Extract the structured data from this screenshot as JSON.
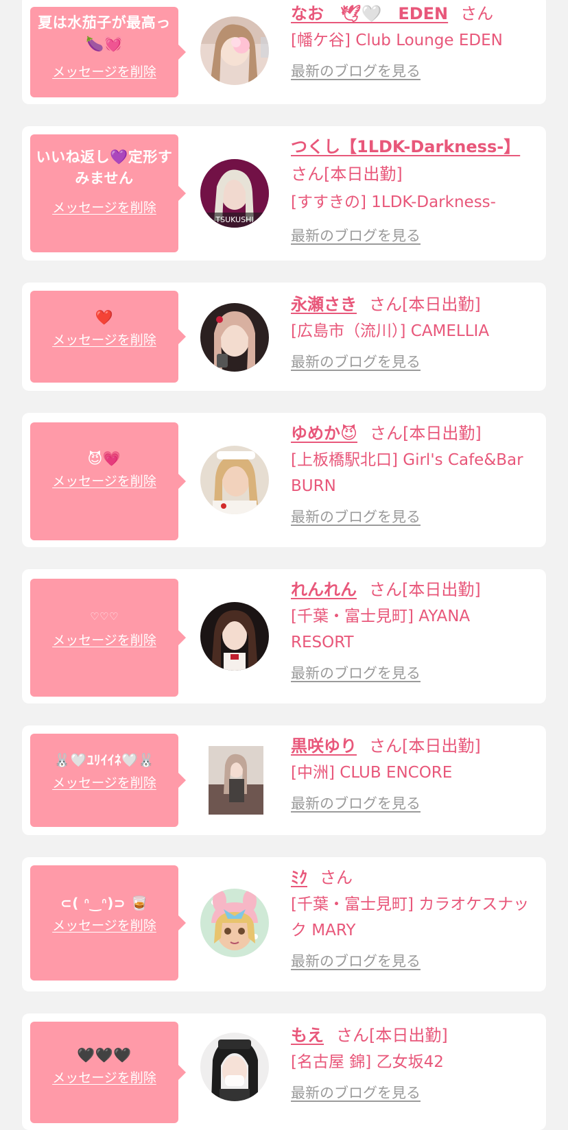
{
  "colors": {
    "background": "#f2f2f2",
    "card": "#ffffff",
    "bubble": "#ff9aa8",
    "accent": "#e8577a",
    "muted_link": "#9a9a9a"
  },
  "entries": [
    {
      "message": "夏は水茄子が最高っ🍆💓",
      "delete_label": "メッセージを削除",
      "name": "なお　🕊🤍　EDEN",
      "san": "さん",
      "status": "",
      "shop": "[幡ケ谷] Club Lounge EDEN",
      "blog_label": "最新のブログを見る",
      "avatar_icon": "avatar-photo"
    },
    {
      "message": "いいね返し💜定形すみません",
      "delete_label": "メッセージを削除",
      "name": "つくし【1LDK-Darkness-】",
      "san": "さん",
      "status": "[本日出勤]",
      "shop": "[すすきの] 1LDK-Darkness-",
      "blog_label": "最新のブログを見る",
      "avatar_icon": "avatar-photo"
    },
    {
      "message": "❤️",
      "delete_label": "メッセージを削除",
      "name": "永瀬さき",
      "san": "さん",
      "status": "[本日出勤]",
      "shop": "[広島市（流川）] CAMELLIA",
      "blog_label": "最新のブログを見る",
      "avatar_icon": "avatar-photo"
    },
    {
      "message": "😈💗",
      "delete_label": "メッセージを削除",
      "name": "ゆめか😈",
      "san": "さん",
      "status": "[本日出勤]",
      "shop": "[上板橋駅北口] Girl's Cafe&Bar BURN",
      "blog_label": "最新のブログを見る",
      "avatar_icon": "avatar-photo"
    },
    {
      "message": "♡♡♡",
      "delete_label": "メッセージを削除",
      "name": "れんれん",
      "san": "さん",
      "status": "[本日出勤]",
      "shop": "[千葉・富士見町] AYANA RESORT",
      "blog_label": "最新のブログを見る",
      "avatar_icon": "avatar-photo"
    },
    {
      "message": "🐰🤍ﾕﾘｲｲﾈ🤍🐰",
      "delete_label": "メッセージを削除",
      "name": "黒咲ゆり",
      "san": "さん",
      "status": "[本日出勤]",
      "shop": "[中洲] CLUB ENCORE",
      "blog_label": "最新のブログを見る",
      "avatar_icon": "avatar-photo"
    },
    {
      "message": "⊂( ᐢ‿ᐢ)⊃ 🥃",
      "delete_label": "メッセージを削除",
      "name": "ﾐｸ",
      "san": "さん",
      "status": "",
      "shop": "[千葉・富士見町] カラオケスナック MARY",
      "blog_label": "最新のブログを見る",
      "avatar_icon": "avatar-illustration"
    },
    {
      "message": "🖤🖤🖤",
      "delete_label": "メッセージを削除",
      "name": "もえ",
      "san": "さん",
      "status": "[本日出勤]",
      "shop": "[名古屋 錦] 乙女坂42",
      "blog_label": "最新のブログを見る",
      "avatar_icon": "avatar-photo"
    }
  ]
}
